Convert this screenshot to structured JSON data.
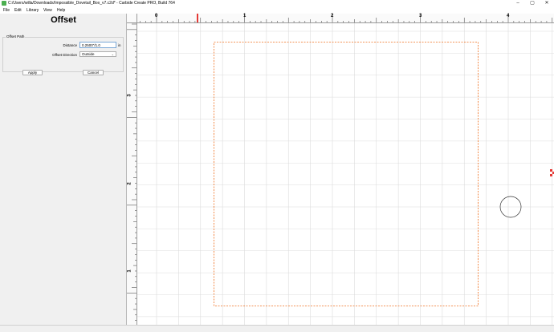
{
  "window": {
    "title": "C:/Users/willa/Downloads/Impossible_Dovetail_Box_v7.c2d* - Carbide Create PRO, Build 764",
    "minimize": "–",
    "maximize": "▢",
    "close": "✕"
  },
  "menu": {
    "file": "File",
    "edit": "Edit",
    "library": "Library",
    "view": "View",
    "help": "Help"
  },
  "panel": {
    "title": "Offset",
    "group_label": "Offset Path",
    "distance_label": "Distance",
    "distance_value": "0.2500\"/1.0",
    "distance_unit": "in",
    "direction_label": "Offset Direction",
    "direction_value": "Outside",
    "apply_label": "Apply",
    "cancel_label": "Cancel"
  },
  "rulers": {
    "x_labels": [
      "0",
      "1",
      "2",
      "3",
      "4"
    ],
    "y_labels": [
      "3",
      "2",
      "1"
    ]
  },
  "colors": {
    "offset_path": "#f07020",
    "grid": "#dcdcdc",
    "ruler_marker": "#e53935",
    "tool_marker": "#e53935"
  }
}
